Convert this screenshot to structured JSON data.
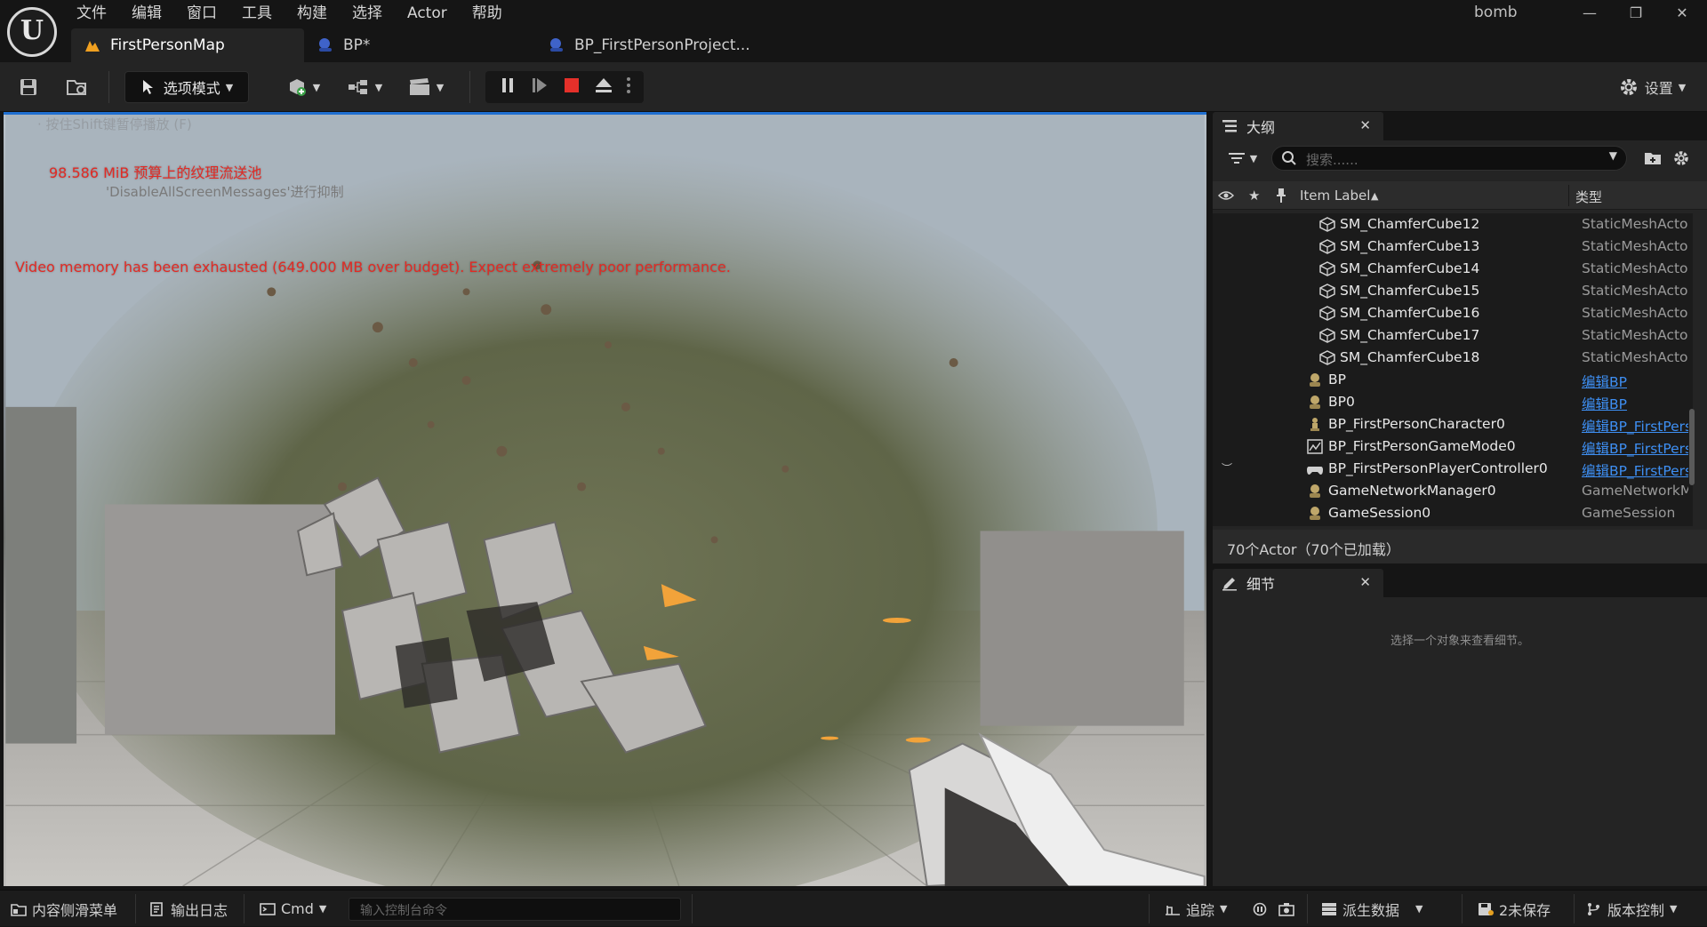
{
  "menu": [
    "文件",
    "编辑",
    "窗口",
    "工具",
    "构建",
    "选择",
    "Actor",
    "帮助"
  ],
  "project_name": "bomb",
  "window": {
    "minimize": "—",
    "restore": "❐",
    "close": "✕"
  },
  "tabs": [
    {
      "label": "FirstPersonMap",
      "icon": "level-icon"
    },
    {
      "label": "BP*",
      "icon": "blueprint-icon"
    },
    {
      "label": "BP_FirstPersonProject...",
      "icon": "blueprint-icon"
    }
  ],
  "toolbar": {
    "mode_label": "选项模式",
    "settings_label": "设置"
  },
  "viewport": {
    "msg_hidden_top": "· 按住Shift键暂停播放 (F)",
    "msg_texture": "98.586 MiB 预算上的纹理流送池",
    "msg_disable": "'DisableAllScreenMessages'进行抑制",
    "msg_video_memory": "Video memory has been exhausted (649.000 MB over budget). Expect extremely poor performance."
  },
  "outliner": {
    "title": "大纲",
    "search_placeholder": "搜索......",
    "col_label": "Item Label",
    "col_type": "类型",
    "rows": [
      {
        "label": "SM_ChamferCube12",
        "type": "StaticMeshActor",
        "link": false,
        "indent": 2,
        "icon": "static-mesh-icon"
      },
      {
        "label": "SM_ChamferCube13",
        "type": "StaticMeshActor",
        "link": false,
        "indent": 2,
        "icon": "static-mesh-icon"
      },
      {
        "label": "SM_ChamferCube14",
        "type": "StaticMeshActor",
        "link": false,
        "indent": 2,
        "icon": "static-mesh-icon"
      },
      {
        "label": "SM_ChamferCube15",
        "type": "StaticMeshActor",
        "link": false,
        "indent": 2,
        "icon": "static-mesh-icon"
      },
      {
        "label": "SM_ChamferCube16",
        "type": "StaticMeshActor",
        "link": false,
        "indent": 2,
        "icon": "static-mesh-icon"
      },
      {
        "label": "SM_ChamferCube17",
        "type": "StaticMeshActor",
        "link": false,
        "indent": 2,
        "icon": "static-mesh-icon"
      },
      {
        "label": "SM_ChamferCube18",
        "type": "StaticMeshActor",
        "link": false,
        "indent": 2,
        "icon": "static-mesh-icon"
      },
      {
        "label": "BP",
        "type": "编辑BP",
        "link": true,
        "indent": 1,
        "icon": "actor-icon"
      },
      {
        "label": "BP0",
        "type": "编辑BP",
        "link": true,
        "indent": 1,
        "icon": "actor-icon"
      },
      {
        "label": "BP_FirstPersonCharacter0",
        "type": "编辑BP_FirstPersonCharacter",
        "link": true,
        "indent": 1,
        "icon": "character-icon"
      },
      {
        "label": "BP_FirstPersonGameMode0",
        "type": "编辑BP_FirstPersonGameMode",
        "link": true,
        "indent": 1,
        "icon": "gamemode-icon"
      },
      {
        "label": "BP_FirstPersonPlayerController0",
        "type": "编辑BP_FirstPersonPlayerController",
        "link": true,
        "indent": 1,
        "icon": "controller-icon",
        "hidden_eye": true
      },
      {
        "label": "GameNetworkManager0",
        "type": "GameNetworkManager",
        "link": false,
        "indent": 1,
        "icon": "actor-icon"
      },
      {
        "label": "GameSession0",
        "type": "GameSession",
        "link": false,
        "indent": 1,
        "icon": "actor-icon"
      }
    ],
    "footer": "70个Actor（70个已加载）"
  },
  "details": {
    "title": "细节",
    "empty_message": "选择一个对象来查看细节。"
  },
  "statusbar": {
    "content_drawer": "内容侧滑菜单",
    "output_log": "输出日志",
    "cmd": "Cmd",
    "cmd_placeholder": "输入控制台命令",
    "trace": "追踪",
    "derived_data": "派生数据",
    "unsaved": "2未保存",
    "source_control": "版本控制"
  },
  "colors": {
    "accent_blue": "#1f6fd1",
    "stop_red": "#e5302a",
    "link_blue": "#3e8ff3",
    "warning_red": "#e22a24",
    "map_tab_orange": "#f0a020"
  }
}
